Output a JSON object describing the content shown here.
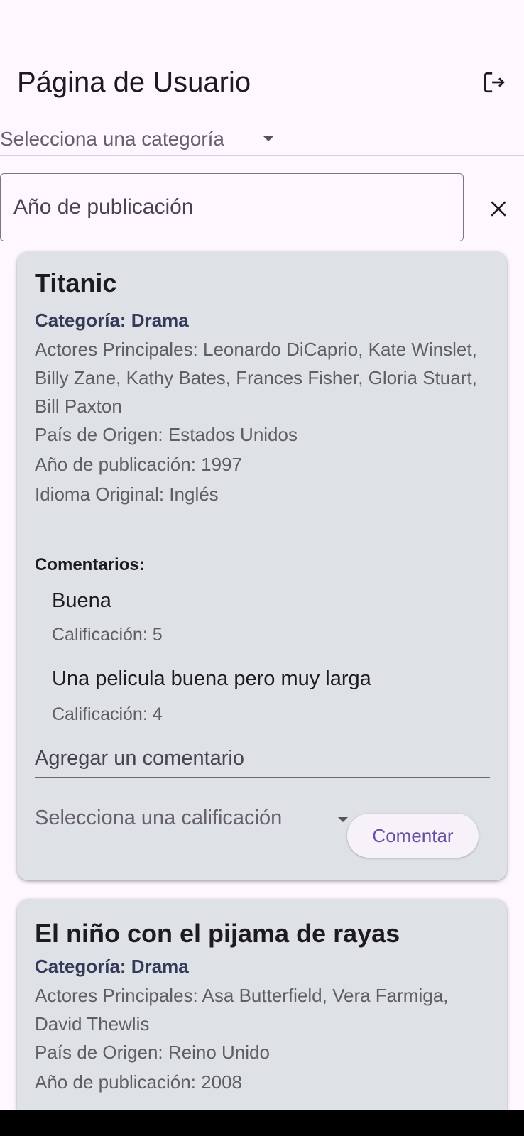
{
  "app_bar": {
    "title": "Página de Usuario",
    "logout_icon": "logout-icon"
  },
  "category_filter": {
    "label": "Selecciona una categoría"
  },
  "year_filter": {
    "placeholder": "Año de publicación",
    "clear_icon": "close-icon"
  },
  "movies": [
    {
      "title": "Titanic",
      "category": "Categoría: Drama",
      "actors": "Actores Principales: Leonardo DiCaprio, Kate Winslet, Billy Zane, Kathy Bates, Frances Fisher, Gloria Stuart, Bill Paxton",
      "country": "País de Origen: Estados Unidos",
      "year": "Año de publicación: 1997",
      "language": "Idioma Original: Inglés",
      "comments_heading": "Comentarios:",
      "comments": [
        {
          "text": "Buena",
          "rating": "Calificación: 5"
        },
        {
          "text": "Una pelicula buena pero muy larga",
          "rating": "Calificación: 4"
        }
      ],
      "add_comment_placeholder": "Agregar un comentario",
      "rating_select_label": "Selecciona una calificación",
      "comment_button": "Comentar"
    },
    {
      "title": "El niño con el pijama de rayas",
      "category": "Categoría: Drama",
      "actors": "Actores Principales: Asa Butterfield, Vera Farmiga, David Thewlis",
      "country": "País de Origen: Reino Unido",
      "year": "Año de publicación: 2008"
    }
  ],
  "colors": {
    "background": "#fef7ff",
    "card": "#dee1e5",
    "category_text": "#333a5a",
    "button_text": "#6750a4"
  }
}
